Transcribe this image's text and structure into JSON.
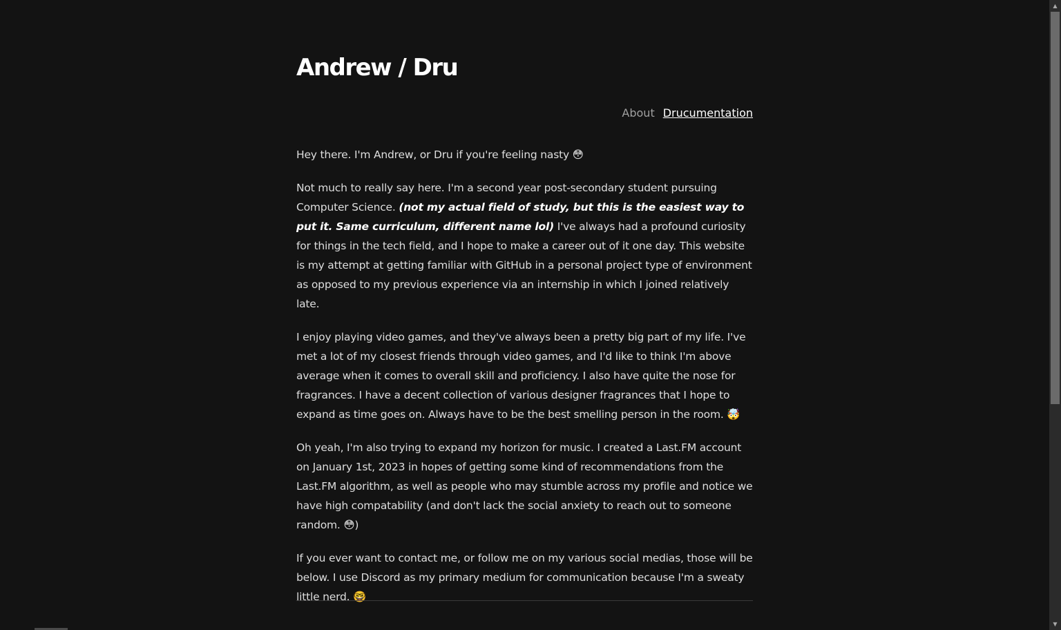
{
  "site": {
    "title": "Andrew / Dru"
  },
  "nav": {
    "items": [
      {
        "label": "About",
        "active": false
      },
      {
        "label": "Drucumentation",
        "active": true
      }
    ]
  },
  "content": {
    "p1": "Hey there. I'm Andrew, or Dru if you're feeling nasty 😳",
    "p2_before": "Not much to really say here. I'm a second year post-secondary student pursuing Computer Science. ",
    "p2_emphasis": "(not my actual field of study, but this is the easiest way to put it. Same curriculum, different name lol)",
    "p2_after": " I've always had a profound curiosity for things in the tech field, and I hope to make a career out of it one day. This website is my attempt at getting familiar with GitHub in a personal project type of environment as opposed to my previous experience via an internship in which I joined relatively late.",
    "p3": "I enjoy playing video games, and they've always been a pretty big part of my life. I've met a lot of my closest friends through video games, and I'd like to think I'm above average when it comes to overall skill and proficiency. I also have quite the nose for fragrances. I have a decent collection of various designer fragrances that I hope to expand as time goes on. Always have to be the best smelling person in the room. 🤯",
    "p4": "Oh yeah, I'm also trying to expand my horizon for music. I created a Last.FM account on January 1st, 2023 in hopes of getting some kind of recommendations from the Last.FM algorithm, as well as people who may stumble across my profile and notice we have high compatability (and don't lack the social anxiety to reach out to someone random. 😳)",
    "p5": "If you ever want to contact me, or follow me on my various social medias, those will be below. I use Discord as my primary medium for communication because I'm a sweaty little nerd. 🤓"
  },
  "scrollbar": {
    "up_icon": "chevron-up-icon",
    "down_icon": "chevron-down-icon",
    "up_glyph": "▲",
    "down_glyph": "▼"
  }
}
